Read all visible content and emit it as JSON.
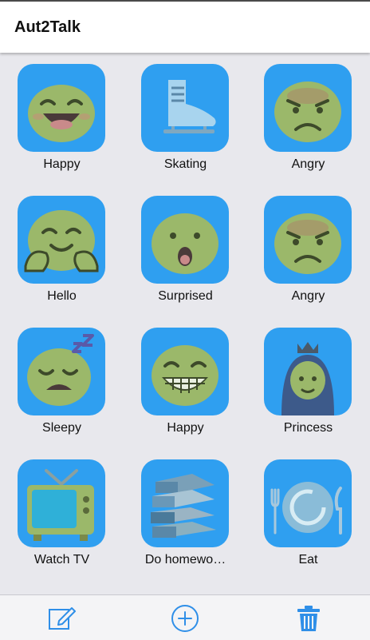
{
  "app": {
    "title": "Aut2Talk"
  },
  "cards": [
    {
      "label": "Happy",
      "icon": "grinning-face-icon"
    },
    {
      "label": "Skating",
      "icon": "ice-skate-icon"
    },
    {
      "label": "Angry",
      "icon": "angry-face-icon"
    },
    {
      "label": "Hello",
      "icon": "hugging-face-icon"
    },
    {
      "label": "Surprised",
      "icon": "surprised-face-icon"
    },
    {
      "label": "Angry",
      "icon": "angry-face-icon"
    },
    {
      "label": "Sleepy",
      "icon": "sleeping-face-icon"
    },
    {
      "label": "Happy",
      "icon": "grinning-teeth-face-icon"
    },
    {
      "label": "Princess",
      "icon": "princess-icon"
    },
    {
      "label": "Watch TV",
      "icon": "television-icon"
    },
    {
      "label": "Do homewo…",
      "icon": "books-icon"
    },
    {
      "label": "Eat",
      "icon": "plate-utensils-icon"
    }
  ],
  "toolbar": {
    "edit_icon": "edit-icon",
    "add_icon": "add-circle-icon",
    "delete_icon": "trash-icon"
  },
  "colors": {
    "tile": "#2f9ff0",
    "face": "#9bb86a",
    "accent": "#2f8fe8",
    "background": "#e8e8ed"
  }
}
